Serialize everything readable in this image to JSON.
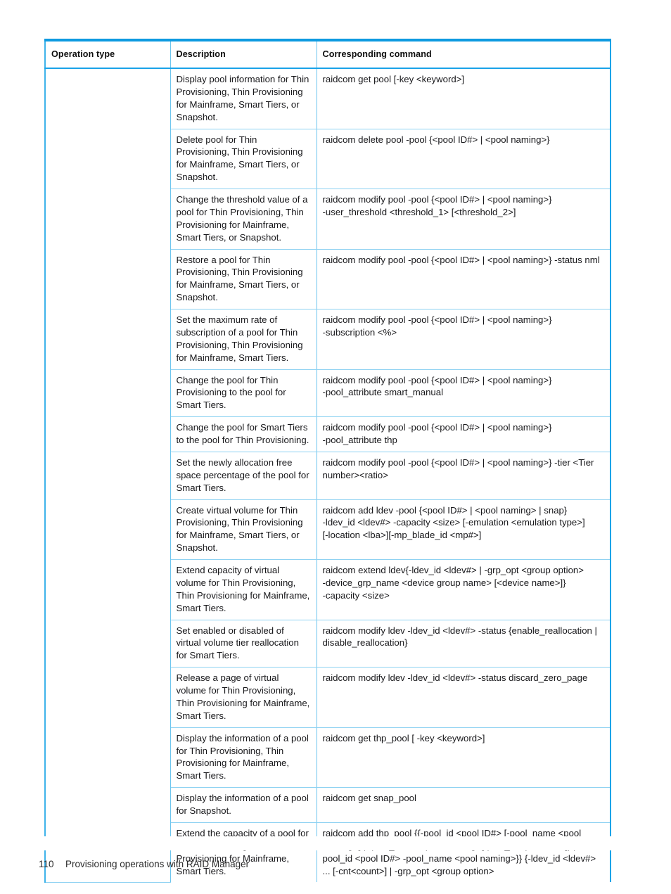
{
  "document": {
    "page_number": "110",
    "footer_title": "Provisioning operations with RAID Manager"
  },
  "colors": {
    "table_border_outer": "#1aa3e8",
    "table_border_inner": "#8ed2f2",
    "header_rule": "#0e9ae0",
    "text": "#17171a"
  },
  "table": {
    "columns": [
      {
        "key": "operation_type",
        "label": "Operation type"
      },
      {
        "key": "description",
        "label": "Description"
      },
      {
        "key": "corresponding_command",
        "label": "Corresponding command"
      }
    ],
    "rows": [
      {
        "operation_type": "",
        "description": "Display pool information for Thin Provisioning, Thin Provisioning for Mainframe, Smart Tiers, or Snapshot.",
        "corresponding_command": "raidcom get pool [-key <keyword>]"
      },
      {
        "operation_type": "",
        "description": "Delete pool for Thin Provisioning, Thin Provisioning for Mainframe, Smart Tiers, or Snapshot.",
        "corresponding_command": "raidcom delete pool -pool {<pool ID#> | <pool naming>}"
      },
      {
        "operation_type": "",
        "description": "Change the threshold value of a pool for Thin Provisioning, Thin Provisioning for Mainframe, Smart Tiers, or Snapshot.",
        "corresponding_command": "raidcom modify pool -pool {<pool ID#> | <pool naming>}\n-user_threshold <threshold_1> [<threshold_2>]"
      },
      {
        "operation_type": "",
        "description": "Restore a pool for Thin Provisioning, Thin Provisioning for Mainframe, Smart Tiers, or Snapshot.",
        "corresponding_command": "raidcom modify pool -pool {<pool ID#> | <pool naming>} -status nml"
      },
      {
        "operation_type": "",
        "description": "Set the maximum rate of subscription of a pool for Thin Provisioning, Thin Provisioning for Mainframe, Smart Tiers.",
        "corresponding_command": "raidcom modify pool -pool {<pool ID#> | <pool naming>}\n-subscription <%>"
      },
      {
        "operation_type": "",
        "description": "Change the pool for Thin Provisioning to the pool for Smart Tiers.",
        "corresponding_command": "raidcom modify pool -pool {<pool ID#> | <pool naming>}\n-pool_attribute smart_manual"
      },
      {
        "operation_type": "",
        "description": "Change the pool for Smart Tiers to the pool for Thin Provisioning.",
        "corresponding_command": "raidcom modify pool -pool {<pool ID#> | <pool naming>}\n-pool_attribute thp"
      },
      {
        "operation_type": "",
        "description": "Set the newly allocation free space percentage of the pool for Smart Tiers.",
        "corresponding_command": "raidcom modify pool -pool {<pool ID#> | <pool naming>} -tier <Tier number><ratio>"
      },
      {
        "operation_type": "",
        "description": "Create virtual volume for Thin Provisioning, Thin Provisioning for Mainframe, Smart Tiers, or Snapshot.",
        "corresponding_command": "raidcom add ldev -pool {<pool ID#> | <pool naming> | snap}\n-ldev_id <ldev#> -capacity <size> [-emulation <emulation type>]\n[-location <lba>][-mp_blade_id <mp#>]"
      },
      {
        "operation_type": "",
        "description": "Extend capacity of virtual volume for Thin Provisioning, Thin Provisioning for Mainframe, Smart Tiers.",
        "corresponding_command": "raidcom extend ldev{-ldev_id <ldev#> | -grp_opt <group option>\n-device_grp_name <device group name> [<device name>]}\n-capacity <size>"
      },
      {
        "operation_type": "",
        "description": "Set enabled or disabled of virtual volume tier reallocation for Smart Tiers.",
        "corresponding_command": "raidcom modify ldev -ldev_id <ldev#> -status {enable_reallocation | disable_reallocation}"
      },
      {
        "operation_type": "",
        "description": "Release a page of virtual volume for Thin Provisioning, Thin Provisioning for Mainframe, Smart Tiers.",
        "corresponding_command": "raidcom modify ldev -ldev_id <ldev#> -status discard_zero_page"
      },
      {
        "operation_type": "",
        "description": "Display the information of a pool for Thin Provisioning, Thin Provisioning for Mainframe, Smart Tiers.",
        "corresponding_command": "raidcom get thp_pool [ -key <keyword>]"
      },
      {
        "operation_type": "",
        "description": "Display the information of a pool for Snapshot.",
        "corresponding_command": "raidcom get snap_pool"
      },
      {
        "operation_type": "",
        "description": "Extend the capacity of a pool for Thin Provisioning, Thin Provisioning for Mainframe, Smart Tiers.",
        "corresponding_command": "raidcom add thp_pool {{-pool_id <pool ID#> [-pool_name <pool naming>] | -pool_name <pool naming>[-pool_id <pool ID#>]} | -pool_id <pool ID#> -pool_name <pool naming>}} {-ldev_id <ldev#> ... [-cnt<count>] | -grp_opt <group option>"
      }
    ]
  }
}
